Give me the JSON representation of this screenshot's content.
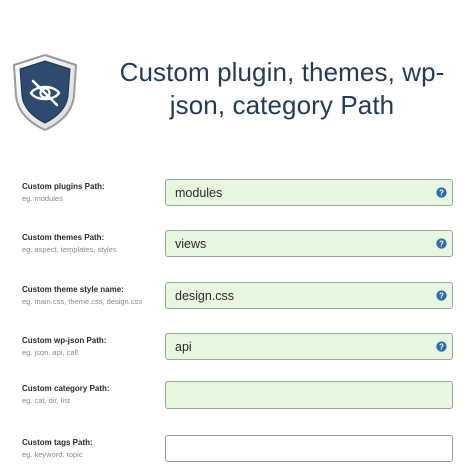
{
  "header": {
    "title": "Custom plugin, themes, wp-json, category Path",
    "logo_icon": "shield-hidden-eye-icon"
  },
  "colors": {
    "title": "#1f3c5c",
    "field_filled_bg": "#e6f6df",
    "help_icon": "#2c6cb0"
  },
  "fields": [
    {
      "label": "Custom plugins Path:",
      "hint": "eg. modules",
      "value": "modules",
      "help_icon": "question-circle-icon"
    },
    {
      "label": "Custom themes Path:",
      "hint": "eg. aspect, templates, styles",
      "value": "views",
      "help_icon": "question-circle-icon"
    },
    {
      "label": "Custom theme style name:",
      "hint": "eg. main.css, theme.css, design.css",
      "value": "design.css",
      "help_icon": "question-circle-icon"
    },
    {
      "label": "Custom wp-json Path:",
      "hint": "eg. json, api, call",
      "value": "api",
      "help_icon": "question-circle-icon"
    },
    {
      "label": "Custom category Path:",
      "hint": "eg. cat, dir, list",
      "value": ""
    },
    {
      "label": "Custom tags Path:",
      "hint": "eg. keyword, topic",
      "value": ""
    }
  ]
}
